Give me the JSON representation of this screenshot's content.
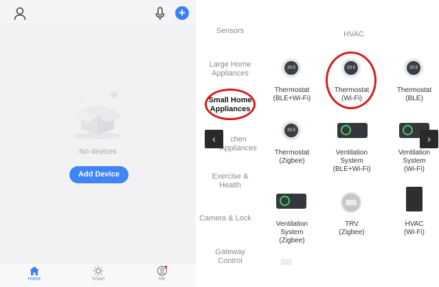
{
  "left_phone": {
    "top_bar": {
      "profile_icon": "person-outline-icon",
      "mic_icon": "microphone-icon",
      "add_icon": "plus-circle-icon",
      "add_symbol": "+"
    },
    "empty_state": {
      "illustration": "empty-box-icon",
      "message": "No devices",
      "add_button_label": "Add Device"
    },
    "bottom_nav": [
      {
        "label": "Home",
        "icon": "home-icon",
        "active": true
      },
      {
        "label": "Smart",
        "icon": "sun-icon",
        "active": false
      },
      {
        "label": "Me",
        "icon": "person-circle-icon",
        "active": false
      }
    ],
    "accent_color": "#3a7ff6"
  },
  "right_panel": {
    "categories": [
      {
        "label_lines": [
          "Sensors"
        ]
      },
      {
        "label_lines": [
          "Large Home",
          "Appliances"
        ]
      },
      {
        "label_lines": [
          "Small Home",
          "Appliances"
        ],
        "selected": true
      },
      {
        "label_lines": [
          "chen",
          "Appliances"
        ]
      },
      {
        "label_lines": [
          "Exercise &",
          "Health"
        ]
      },
      {
        "label_lines": [
          "Camera & Lock"
        ]
      },
      {
        "label_lines": [
          "Gateway",
          "Control"
        ]
      }
    ],
    "section_title": "HVAC",
    "devices": [
      {
        "label_lines": [
          "Thermostat",
          "(BLE+Wi-Fi)"
        ],
        "icon": "thermostat-icon",
        "display": "20.5"
      },
      {
        "label_lines": [
          "Thermostat",
          "(Wi-Fi)"
        ],
        "icon": "thermostat-icon",
        "display": "20.5",
        "highlighted": true
      },
      {
        "label_lines": [
          "Thermostat",
          "(BLE)"
        ],
        "icon": "thermostat-icon",
        "display": "20.5"
      },
      {
        "label_lines": [
          "Thermostat",
          "(Zigbee)"
        ],
        "icon": "thermostat-icon",
        "display": "20.5"
      },
      {
        "label_lines": [
          "Ventilation",
          "System",
          "(BLE+Wi-Fi)"
        ],
        "icon": "ventilation-unit-icon"
      },
      {
        "label_lines": [
          "Ventilation",
          "System",
          "(Wi-Fi)"
        ],
        "icon": "ventilation-unit-icon"
      },
      {
        "label_lines": [
          "Ventilation",
          "System",
          "(Zigbee)"
        ],
        "icon": "ventilation-unit-icon"
      },
      {
        "label_lines": [
          "TRV",
          "(Zigbee)"
        ],
        "icon": "radiator-valve-icon"
      },
      {
        "label_lines": [
          "HVAC",
          "(Wi-Fi)"
        ],
        "icon": "hvac-panel-icon"
      }
    ],
    "scroll_left_icon": "chevron-left-icon",
    "scroll_left_glyph": "‹",
    "scroll_right_icon": "chevron-right-icon",
    "scroll_right_glyph": "›",
    "highlight_color": "#d7191f"
  }
}
